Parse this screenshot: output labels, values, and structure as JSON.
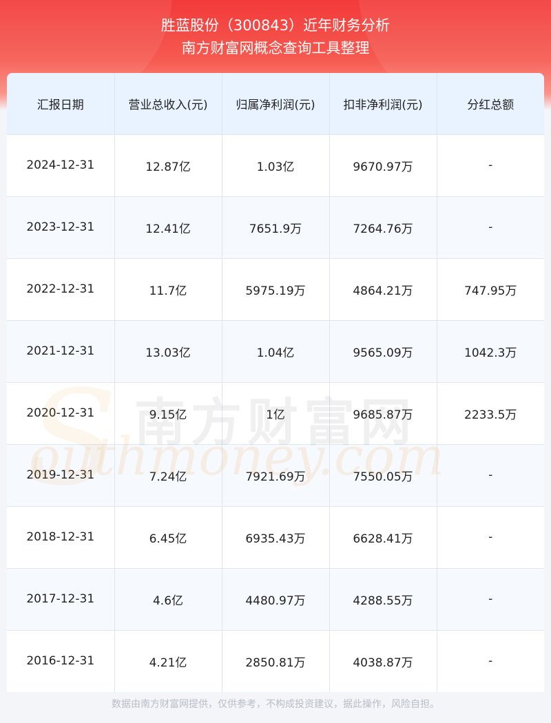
{
  "header": {
    "title_line1": "胜蓝股份（300843）近年财务分析",
    "title_line2": "南方财富网概念查询工具整理"
  },
  "table": {
    "columns": [
      "汇报日期",
      "营业总收入(元)",
      "归属净利润(元)",
      "扣非净利润(元)",
      "分红总额"
    ],
    "rows": [
      [
        "2024-12-31",
        "12.87亿",
        "1.03亿",
        "9670.97万",
        "-"
      ],
      [
        "2023-12-31",
        "12.41亿",
        "7651.9万",
        "7264.76万",
        "-"
      ],
      [
        "2022-12-31",
        "11.7亿",
        "5975.19万",
        "4864.21万",
        "747.95万"
      ],
      [
        "2021-12-31",
        "13.03亿",
        "1.04亿",
        "9565.09万",
        "1042.3万"
      ],
      [
        "2020-12-31",
        "9.15亿",
        "1亿",
        "9685.87万",
        "2233.5万"
      ],
      [
        "2019-12-31",
        "7.24亿",
        "7921.69万",
        "7550.05万",
        "-"
      ],
      [
        "2018-12-31",
        "6.45亿",
        "6935.43万",
        "6628.41万",
        "-"
      ],
      [
        "2017-12-31",
        "4.6亿",
        "4480.97万",
        "4288.55万",
        "-"
      ],
      [
        "2016-12-31",
        "4.21亿",
        "2850.81万",
        "4038.87万",
        "-"
      ]
    ]
  },
  "watermark": {
    "cn": "南方财富网",
    "s_letter": "S",
    "en": "outhmoney.com"
  },
  "footer": {
    "disclaimer": "数据由南方财富网提供，仅供参考，不构成投资建议，据此操作，风险自担。"
  },
  "colors": {
    "header_red": "#f23a3a",
    "table_header_bg": "#e9f3ff",
    "row_alt_bg": "#f6f9fd",
    "border": "#dfe5ee"
  }
}
